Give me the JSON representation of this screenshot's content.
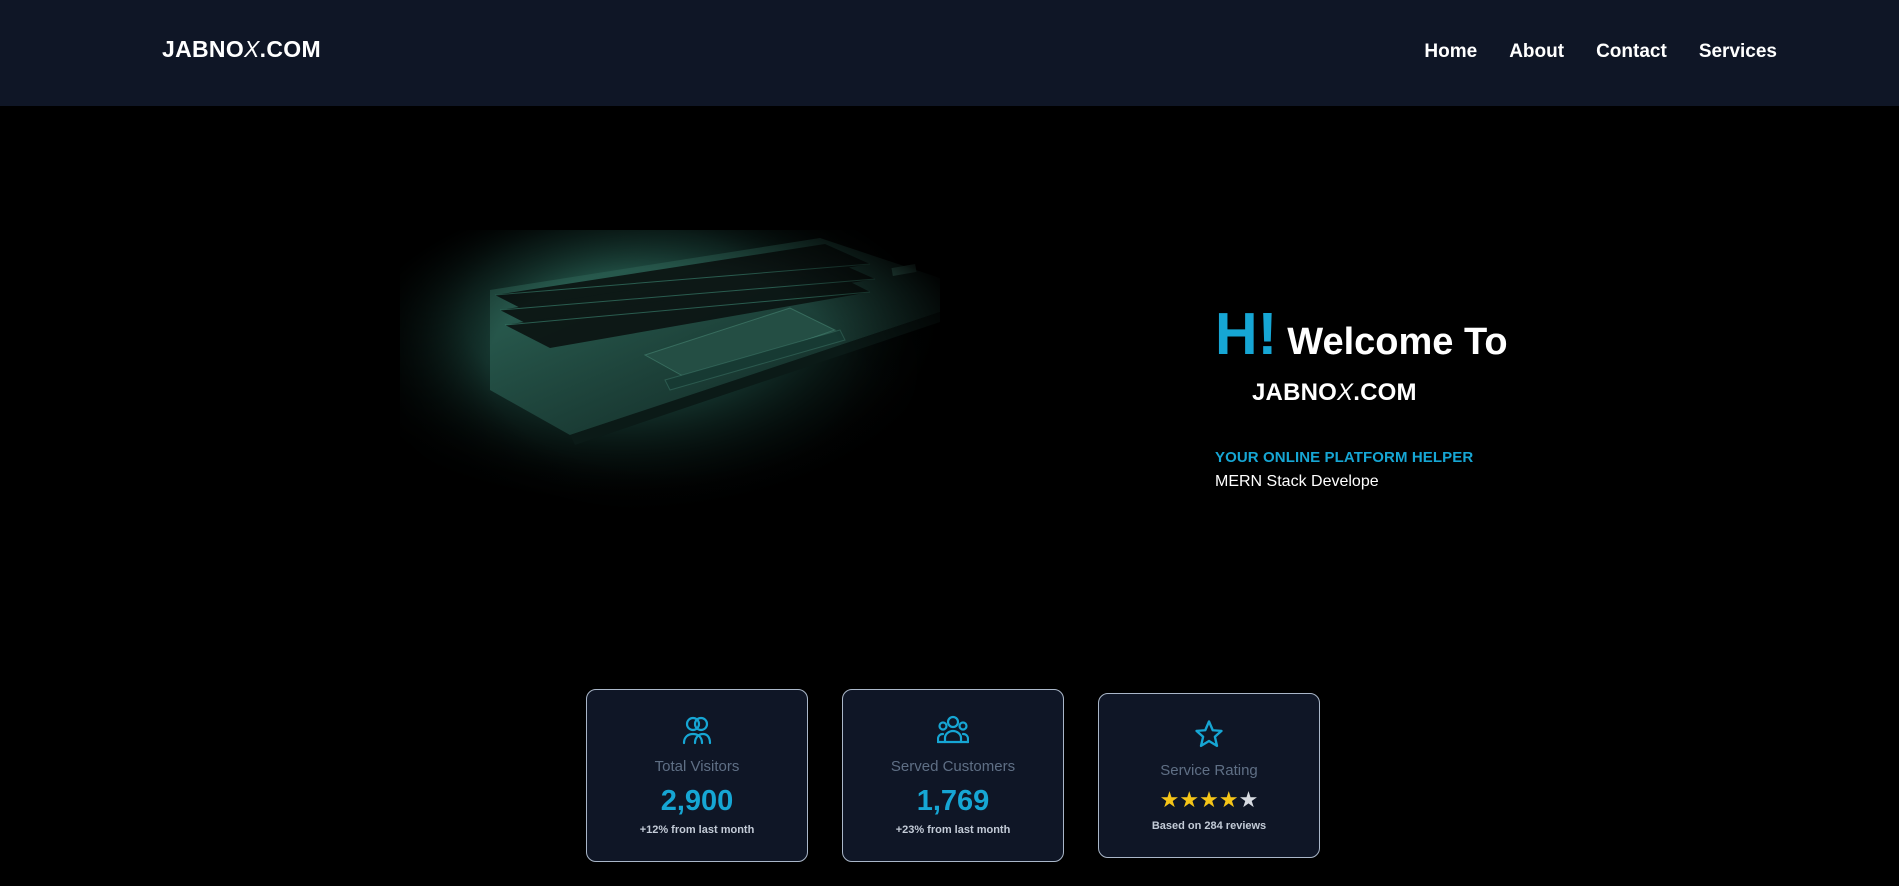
{
  "nav": {
    "logo_prefix": "JABNO",
    "logo_x": "X",
    "logo_suffix": ".COM",
    "links": [
      "Home",
      "About",
      "Contact",
      "Services"
    ]
  },
  "hero": {
    "greeting": "H!",
    "welcome": "Welcome To",
    "brand_prefix": "JABNO",
    "brand_x": "X",
    "brand_suffix": ".COM",
    "tagline": "YOUR ONLINE PLATFORM HELPER",
    "role": "MERN Stack Develope"
  },
  "stats": [
    {
      "icon": "users-icon",
      "label": "Total Visitors",
      "value": "2,900",
      "sub": "+12% from last month"
    },
    {
      "icon": "customers-group-icon",
      "label": "Served Customers",
      "value": "1,769",
      "sub": "+23% from last month"
    },
    {
      "icon": "star-icon",
      "label": "Service Rating",
      "rating": 4,
      "rating_max": 5,
      "sub": "Based on 284 reviews"
    }
  ],
  "colors": {
    "accent": "#16a6d4",
    "nav_bg": "#0f1626",
    "card_bg": "#0f1626",
    "star": "#f5c518"
  }
}
